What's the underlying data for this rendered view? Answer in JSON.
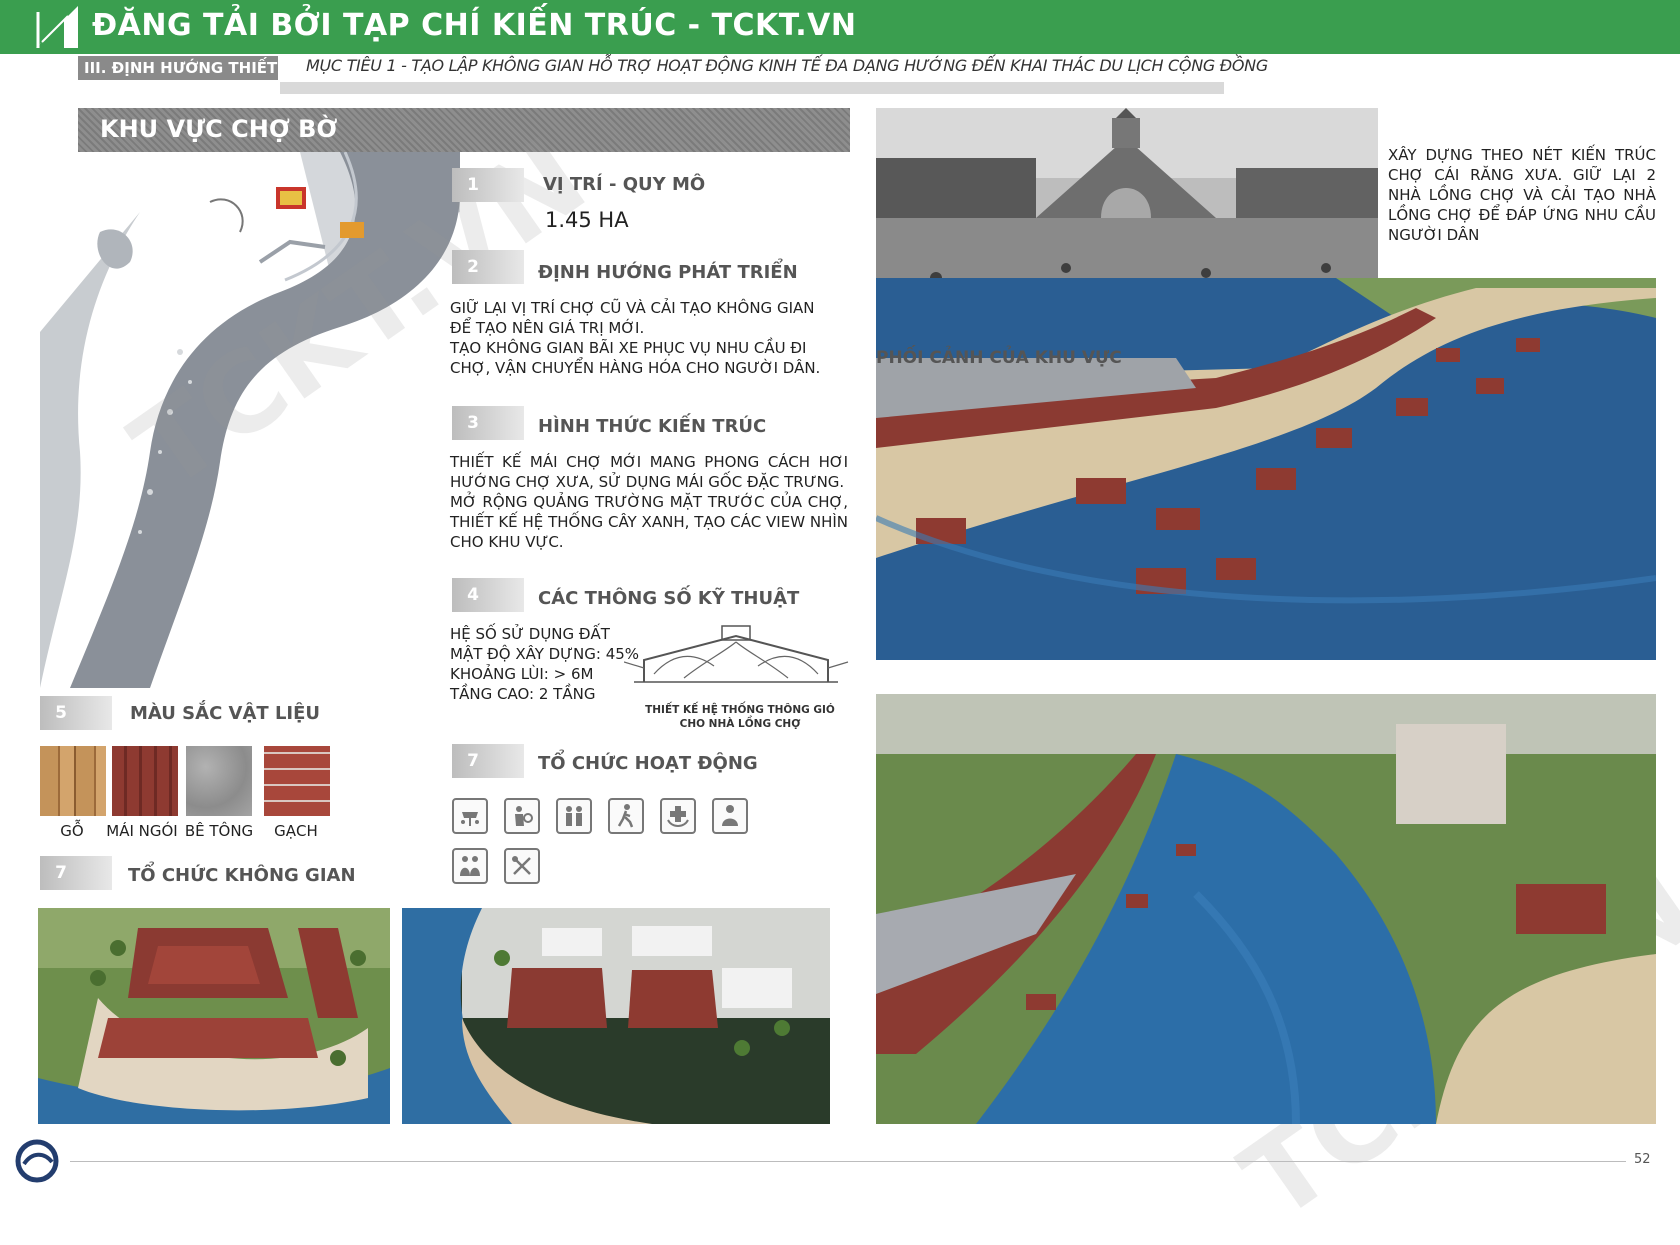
{
  "banner": {
    "title": "ĐĂNG TẢI BỞI TẠP CHÍ KIẾN TRÚC - TCKT.VN"
  },
  "header": {
    "section_tag": "III. ĐỊNH HƯỚNG THIẾT KẾ",
    "goal": "MỤC TIÊU 1 - TẠO LẬP KHÔNG GIAN HỖ TRỢ HOẠT ĐỘNG KINH TẾ ĐA DẠNG HƯỚNG ĐẾN KHAI THÁC DU LỊCH CỘNG ĐỒNG"
  },
  "area": {
    "title": "KHU VỰC CHỢ BỜ"
  },
  "items": [
    {
      "num": "1",
      "title": "VỊ TRÍ - QUY MÔ",
      "value": "1.45 HA"
    },
    {
      "num": "2",
      "title": "ĐỊNH HƯỚNG PHÁT TRIỂN",
      "lines": [
        "GIỮ LẠI VỊ TRÍ CHỢ CŨ VÀ CẢI TẠO KHÔNG GIAN ĐỂ TẠO NÊN GIÁ TRỊ MỚI.",
        "TẠO KHÔNG GIAN BÃI XE PHỤC VỤ NHU CẦU ĐI CHỢ, VẬN CHUYỂN HÀNG HÓA CHO NGƯỜI DÂN."
      ]
    },
    {
      "num": "3",
      "title": "HÌNH THỨC KIẾN TRÚC",
      "lines": [
        "THIẾT KẾ MÁI CHỢ MỚI MANG PHONG CÁCH HƠI HƯỚNG CHỢ XƯA, SỬ DỤNG MÁI GỐC ĐẶC TRƯNG.",
        "MỞ RỘNG QUẢNG TRƯỜNG MẶT TRƯỚC CỦA CHỢ, THIẾT KẾ HỆ THỐNG CÂY XANH, TẠO CÁC VIEW NHÌN CHO KHU VỰC."
      ]
    },
    {
      "num": "4",
      "title": "CÁC THÔNG SỐ KỸ THUẬT",
      "lines": [
        "HỆ SỐ SỬ DỤNG ĐẤT",
        "MẬT ĐỘ XÂY DỰNG: 45%",
        "KHOẢNG LÙI: > 6M",
        "TẦNG CAO: 2 TẦNG"
      ]
    },
    {
      "num": "5",
      "title": "MÀU SẮC VẬT LIỆU"
    },
    {
      "num": "7",
      "title": "TỔ CHỨC KHÔNG GIAN"
    },
    {
      "num": "7",
      "title": "TỔ CHỨC HOẠT ĐỘNG"
    }
  ],
  "ventilation_caption": [
    "THIẾT KẾ HỆ THỐNG THÔNG GIÓ",
    "CHO NHÀ LỒNG CHỢ"
  ],
  "materials": [
    {
      "label": "GỖ",
      "color": "#b88650"
    },
    {
      "label": "MÁI NGÓI",
      "color": "#8b3a32"
    },
    {
      "label": "BÊ TÔNG",
      "color": "#9a9a9a"
    },
    {
      "label": "GẠCH",
      "color": "#a2453a"
    }
  ],
  "historic_photo_text": "XÂY DỰNG THEO NÉT KIẾN TRÚC CHỢ CÁI RĂNG XƯA. GIỮ LẠI 2 NHÀ LỒNG CHỢ VÀ CẢI TẠO NHÀ LỒNG CHỢ ĐỂ ĐÁP ỨNG NHU CẦU NGƯỜI DÂN",
  "perspective_title": "PHỐI CẢNH CỦA KHU VỰC",
  "activity_icons": [
    "dining-icon",
    "shopping-icon",
    "family-icon",
    "walking-icon",
    "service-icon",
    "meeting-icon",
    "community-icon",
    "food-icon"
  ],
  "watermark": "TCKT.VN",
  "footer": {
    "page_number": "52"
  },
  "colors": {
    "banner_green": "#3a9e4f",
    "water_blue": "#2f6ea3",
    "roof_red": "#8b3a32"
  }
}
